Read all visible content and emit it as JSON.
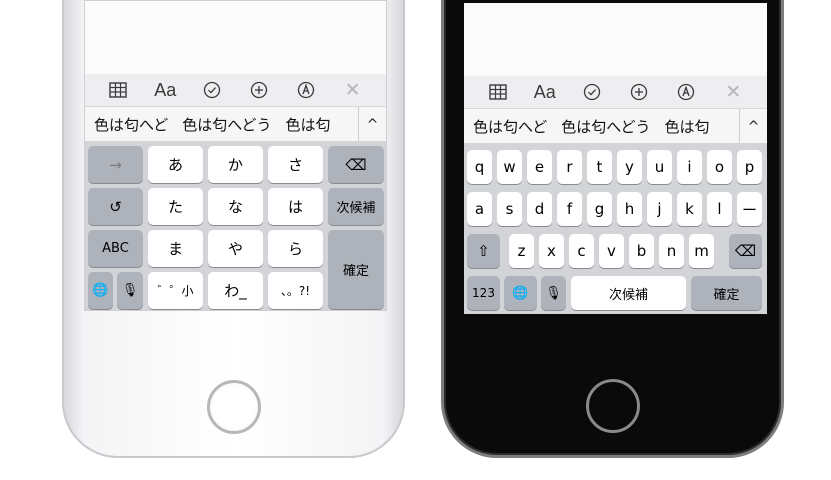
{
  "toolbar_icons": [
    "table-icon",
    "format-icon",
    "checklist-icon",
    "add-icon",
    "markup-icon",
    "close-icon"
  ],
  "toolbar": {
    "format_label": "Aa",
    "close_label": "✕"
  },
  "suggestions": [
    "色は匂へど",
    "色は匂へどう",
    "色は匂"
  ],
  "collapse_label": "^",
  "kana_keyboard": {
    "arrow_key": "→",
    "undo_key": "↺",
    "abc_key": "ABC",
    "globe_key": "🌐",
    "mic_key": "🎙",
    "row1": [
      "あ",
      "か",
      "さ"
    ],
    "row2": [
      "た",
      "な",
      "は"
    ],
    "row3": [
      "ま",
      "や",
      "ら"
    ],
    "row4": [
      "゛゜小",
      "わ_",
      "、。?!"
    ],
    "delete_key": "⌫",
    "convert_key": "次候補",
    "confirm_key": "確定"
  },
  "qwerty_keyboard": {
    "row1": [
      "q",
      "w",
      "e",
      "r",
      "t",
      "y",
      "u",
      "i",
      "o",
      "p"
    ],
    "row2": [
      "a",
      "s",
      "d",
      "f",
      "g",
      "h",
      "j",
      "k",
      "l",
      "ー"
    ],
    "row3": [
      "z",
      "x",
      "c",
      "v",
      "b",
      "n",
      "m"
    ],
    "shift_key": "⇧",
    "delete_key": "⌫",
    "num_key": "123",
    "globe_key": "🌐",
    "mic_key": "🎙",
    "space_key": "次候補",
    "confirm_key": "確定"
  },
  "colors": {
    "keyboard_bg": "#d3d4d8",
    "key_light": "#ffffff",
    "key_dark": "#adb2bb",
    "phone_left_body": "#f4f4f6",
    "phone_right_body": "#0a0a0a"
  }
}
